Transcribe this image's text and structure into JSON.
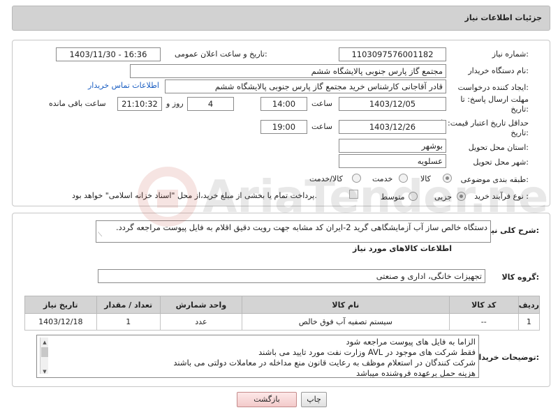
{
  "header": {
    "title": "جزئیات اطلاعات نیاز"
  },
  "form": {
    "need_number_label": "شماره نیاز:",
    "need_number": "1103097576001182",
    "announce_label": "تاریخ و ساعت اعلان عمومی:",
    "announce_value": "1403/11/30 - 16:36",
    "buyer_org_label": "نام دستگاه خریدار:",
    "buyer_org": "مجتمع گاز پارس جنوبی  پالایشگاه ششم",
    "requester_label": "ایجاد کننده درخواست:",
    "requester": "قادر آقاجانی کارشناس خرید مجتمع گاز پارس جنوبی  پالایشگاه ششم",
    "contact_link": "اطلاعات تماس خریدار",
    "deadline_label_1": "مهلت ارسال پاسخ: تا",
    "deadline_label_2": "تاریخ:",
    "deadline_date": "1403/12/05",
    "time_label": "ساعت",
    "deadline_time": "14:00",
    "days_value": "4",
    "days_label": "روز و",
    "remaining_time": "21:10:32",
    "remaining_label": "ساعت باقی مانده",
    "validity_label_1": "حداقل تاریخ اعتبار قیمت: تا",
    "validity_label_2": "تاریخ:",
    "validity_date": "1403/12/26",
    "validity_time": "19:00",
    "province_label": "استان محل تحویل:",
    "province": "بوشهر",
    "city_label": "شهر محل تحویل:",
    "city": "عسلویه",
    "category_label": "طبقه بندی موضوعی:",
    "category_options": [
      "کالا",
      "خدمت",
      "کالا/خدمت"
    ],
    "category_selected": "کالا",
    "process_label": "نوع فرآیند خرید :",
    "process_options": [
      "جزیی",
      "متوسط"
    ],
    "process_selected": "جزیی",
    "payment_note": "پرداخت تمام یا بخشی از مبلغ خرید،از محل \"اسناد خزانه اسلامی\" خواهد بود."
  },
  "summary": {
    "label": "شرح کلی نیاز:",
    "text": "دستگاه خالص ساز آب آزمایشگاهی گرید 2-ایران کد مشابه جهت رویت دقیق اقلام به فایل پیوست مراجعه گردد."
  },
  "goods": {
    "section_title": "اطلاعات کالاهای مورد نیاز",
    "group_label": "گروه کالا:",
    "group_value": "تجهیزات خانگی، اداری و صنعتی",
    "columns": [
      "ردیف",
      "کد کالا",
      "نام کالا",
      "واحد شمارش",
      "تعداد / مقدار",
      "تاریخ نیاز"
    ],
    "rows": [
      {
        "row": "1",
        "code": "--",
        "name": "سیستم تصفیه آب فوق خالص",
        "unit": "عدد",
        "qty": "1",
        "date": "1403/12/18"
      }
    ]
  },
  "buyer_notes": {
    "label": "توضیحات خریدار:",
    "lines": [
      "الزاما به فایل های پیوست مراجعه شود",
      "فقط شرکت های موجود در AVL وزارت نفت مورد تایید می باشند",
      "شرکت کنندگان در استعلام موظف به رعایت قانون منع مداخله در معاملات دولتی می باشند",
      "هزینه حمل برعهده فروشنده میباشد"
    ]
  },
  "buttons": {
    "back": "بازگشت",
    "print": "چاپ"
  },
  "watermark": {
    "text": "AriaTender.neT",
    "icon": "aria-logo-icon"
  }
}
